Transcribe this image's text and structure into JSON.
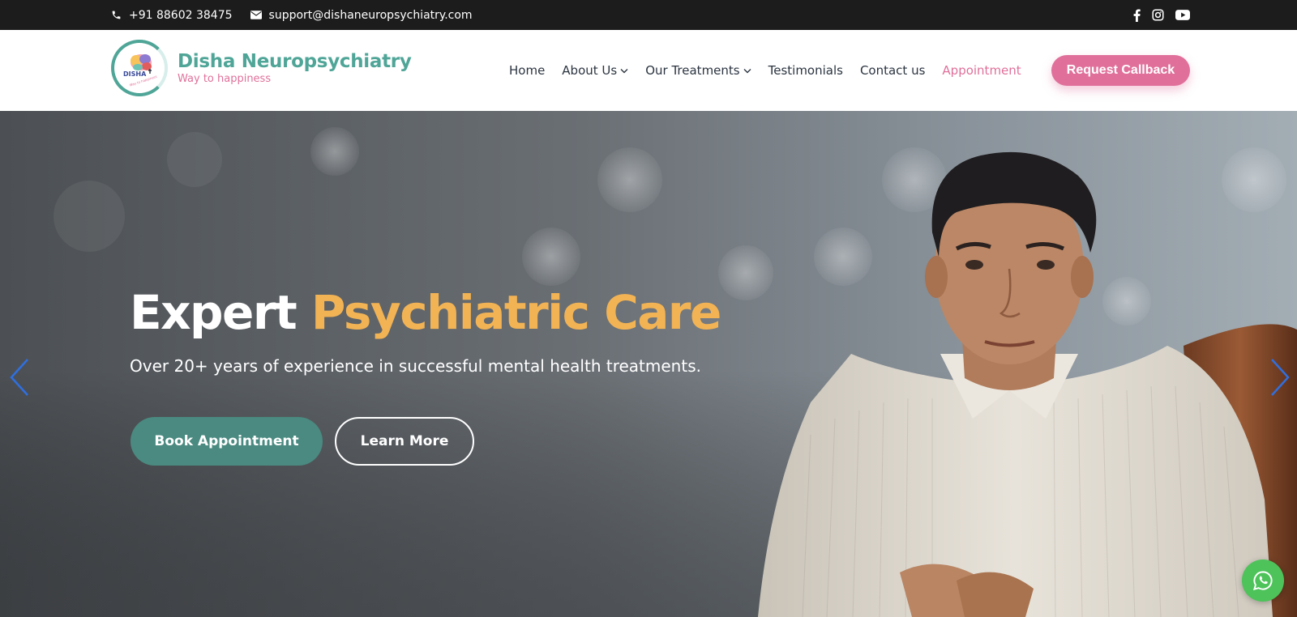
{
  "topbar": {
    "phone": "+91 88602 38475",
    "email": "support@dishaneuropsychiatry.com",
    "phone_icon": "phone-icon",
    "email_icon": "envelope-icon",
    "social": [
      "facebook-icon",
      "instagram-icon",
      "youtube-icon"
    ],
    "bg_color": "#1c1c1c"
  },
  "header": {
    "logo": {
      "title": "Disha Neuropsychiatry",
      "tagline": "Way to happiness",
      "mark_text": "DISHA",
      "mark_subtext": "Way to happiness"
    },
    "nav": [
      {
        "label": "Home",
        "dropdown": false
      },
      {
        "label": "About Us",
        "dropdown": true
      },
      {
        "label": "Our Treatments",
        "dropdown": true
      },
      {
        "label": "Testimonials",
        "dropdown": false
      },
      {
        "label": "Contact us",
        "dropdown": false
      },
      {
        "label": "Appointment",
        "dropdown": false,
        "active": true
      }
    ],
    "cta": "Request Callback"
  },
  "hero": {
    "title_part1": "Expert",
    "title_part2": "Psychiatric Care",
    "subtitle": "Over 20+ years of experience in successful mental health treatments.",
    "primary_button": "Book Appointment",
    "secondary_button": "Learn More",
    "prev_icon": "chevron-left-icon",
    "next_icon": "chevron-right-icon"
  },
  "floating": {
    "whatsapp_icon": "whatsapp-icon"
  },
  "colors": {
    "brand_teal": "#4fa597",
    "brand_pink": "#e0709a",
    "accent_orange": "#f2b354",
    "button_teal": "#4a8a80",
    "whatsapp_green": "#4dc35a",
    "arrow_blue": "#2f6fe0"
  }
}
